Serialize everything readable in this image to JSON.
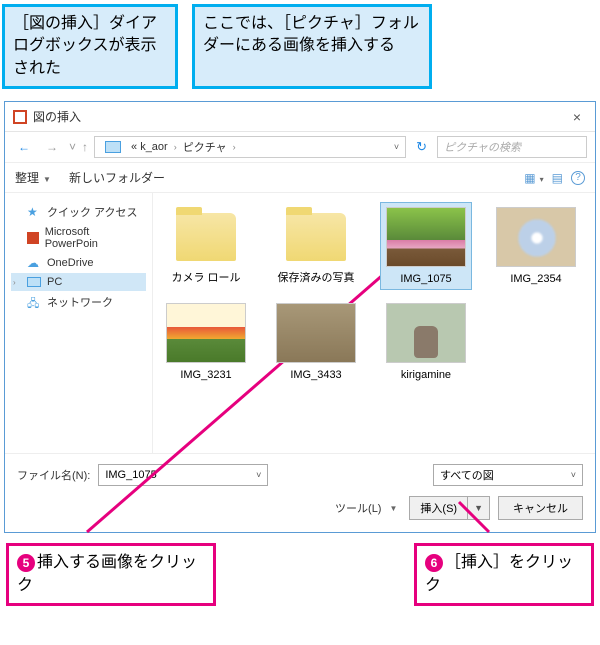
{
  "callouts": {
    "top1": "［図の挿入］ダイアログボックスが表示された",
    "top2": "ここでは、［ピクチャ］フォルダーにある画像を挿入する",
    "bottom1_num": "5",
    "bottom1_text": "挿入する画像をクリック",
    "bottom2_num": "6",
    "bottom2_text": "［挿入］をクリック"
  },
  "dialog": {
    "title": "図の挿入",
    "breadcrumb": {
      "seg1": "« k_aor",
      "seg2": "ピクチャ"
    },
    "search_placeholder": "ピクチャの検索",
    "toolbar": {
      "organize": "整理",
      "new_folder": "新しいフォルダー"
    },
    "sidebar": {
      "items": [
        {
          "label": "クイック アクセス"
        },
        {
          "label": "Microsoft PowerPoin"
        },
        {
          "label": "OneDrive"
        },
        {
          "label": "PC"
        },
        {
          "label": "ネットワーク"
        }
      ]
    },
    "files": [
      {
        "label": "カメラ ロール",
        "kind": "folder"
      },
      {
        "label": "保存済みの写真",
        "kind": "folder"
      },
      {
        "label": "IMG_1075",
        "kind": "img-park",
        "selected": true
      },
      {
        "label": "IMG_2354",
        "kind": "img-flower"
      },
      {
        "label": "IMG_3231",
        "kind": "img-tulip"
      },
      {
        "label": "IMG_3433",
        "kind": "img-sepia"
      },
      {
        "label": "kirigamine",
        "kind": "img-kiri"
      }
    ],
    "filename_label": "ファイル名(N):",
    "filename_value": "IMG_1075",
    "filetype_value": "すべての図",
    "tools_label": "ツール(L)",
    "insert_label": "挿入(S)",
    "cancel_label": "キャンセル"
  }
}
